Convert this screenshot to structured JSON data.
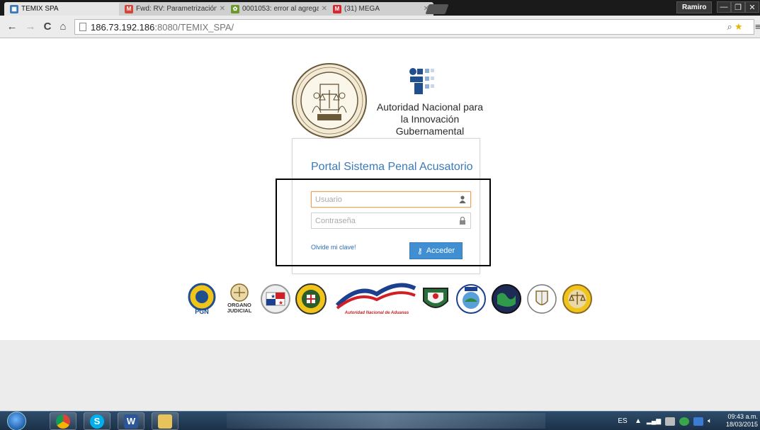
{
  "browser": {
    "tabs": [
      {
        "title": "TEMIX SPA",
        "icon": "page-icon",
        "active": true
      },
      {
        "title": "Fwd: RV: Parametrización",
        "icon": "gmail-icon",
        "active": false
      },
      {
        "title": "0001053: error al agregar a",
        "icon": "mantis-icon",
        "active": false
      },
      {
        "title": "(31) MEGA",
        "icon": "mega-icon",
        "active": false
      }
    ],
    "profile_name": "Ramiro",
    "url_host": "186.73.192.186",
    "url_rest": ":8080/TEMIX_SPA/"
  },
  "header": {
    "seal_text_top": "SISTEMA PENAL ACUSATORIO",
    "seal_text_bottom": "PANAMÁ",
    "agency_line1": "Autoridad Nacional para",
    "agency_line2": "la Innovación Gubernamental"
  },
  "login": {
    "title": "Portal Sistema Penal Acusatorio",
    "username_placeholder": "Usuario",
    "password_placeholder": "Contraseña",
    "forgot_label": "Olvide mi clave!",
    "submit_label": "Acceder"
  },
  "institutions": [
    {
      "label": "PGN"
    },
    {
      "label": "ORGANO JUDICIAL"
    },
    {
      "label": ""
    },
    {
      "label": ""
    },
    {
      "label": "Autoridad Nacional de Aduanas"
    },
    {
      "label": ""
    },
    {
      "label": ""
    },
    {
      "label": ""
    },
    {
      "label": ""
    },
    {
      "label": ""
    }
  ],
  "taskbar": {
    "language": "ES",
    "time": "09:43 a.m.",
    "date": "18/03/2015"
  },
  "colors": {
    "accent_blue": "#3f8fd2",
    "title_blue": "#3b7ab8",
    "focus_orange": "#e9a25c"
  }
}
